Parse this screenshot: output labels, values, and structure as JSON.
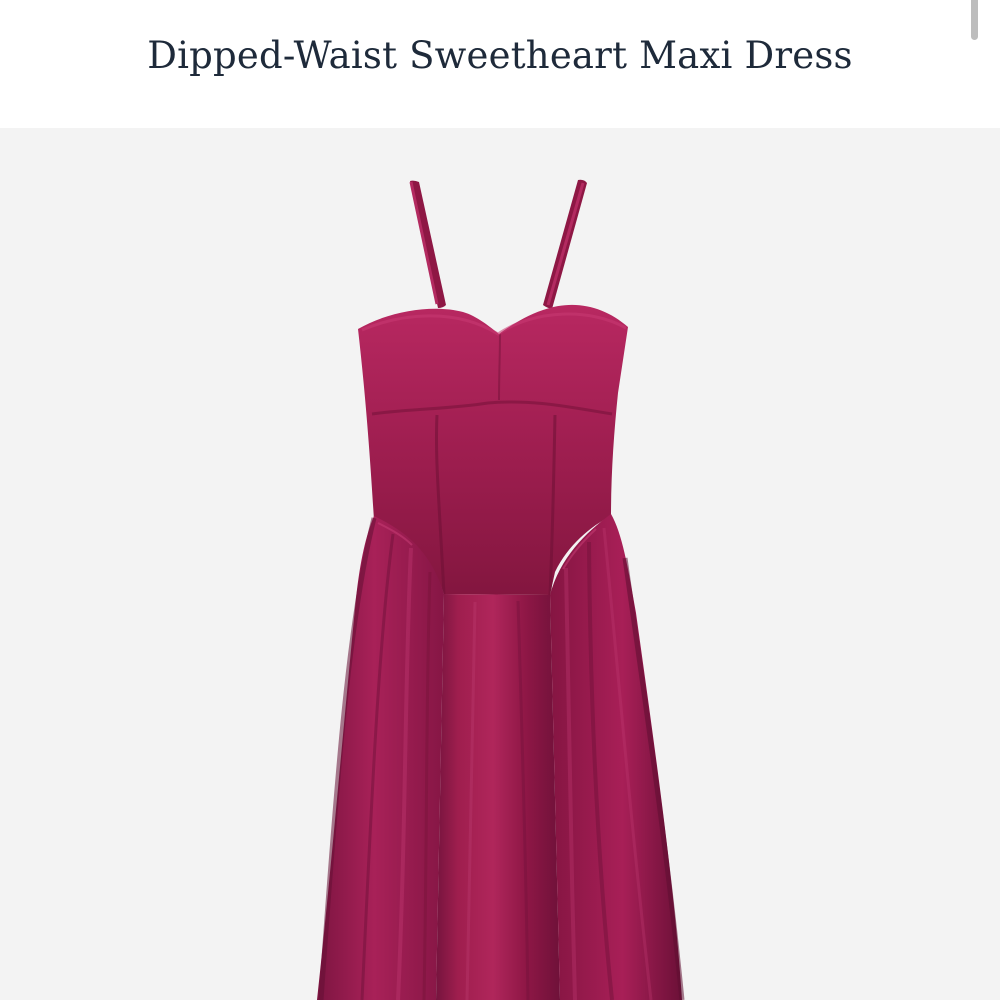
{
  "product": {
    "title": "Dipped-Waist Sweetheart Maxi Dress",
    "image_icon": "dress-image",
    "color": "#9f1e4e"
  },
  "ui": {
    "background": "#ffffff",
    "stage_background": "#f3f3f3",
    "title_color": "#1e2a3a"
  }
}
